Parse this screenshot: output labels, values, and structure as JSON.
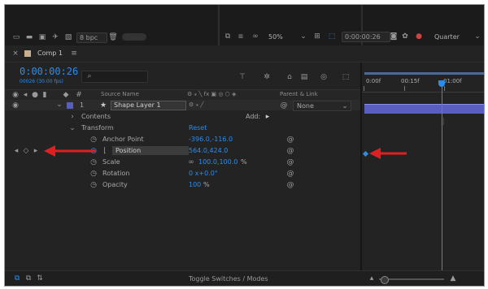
{
  "top": {
    "bpc": "8 bpc",
    "zoom": "50%",
    "timecode": "0:00:00:26",
    "resolution": "Quarter"
  },
  "comp": {
    "tab_label": "Comp 1",
    "timecode": "0:00:00:26",
    "frame_info": "00026 (30.00 fps)",
    "search_placeholder": ""
  },
  "columns": {
    "source_name": "Source Name",
    "parent_link": "Parent & Link"
  },
  "ruler": {
    "ticks": [
      "0:00f",
      "00:15f",
      "01:00f"
    ]
  },
  "layer": {
    "index": "1",
    "name": "Shape Layer 1",
    "parent": "None"
  },
  "props": {
    "contents": "Contents",
    "add_label": "Add:",
    "transform": "Transform",
    "reset": "Reset",
    "anchor_label": "Anchor Point",
    "anchor_value": "-396.0,-116.0",
    "position_label": "Position",
    "position_value": "564.0,424.0",
    "scale_label": "Scale",
    "scale_value": "100.0,100.0",
    "scale_unit": "%",
    "rotation_label": "Rotation",
    "rotation_value": "0 x+0.0°",
    "opacity_label": "Opacity",
    "opacity_value": "100",
    "opacity_unit": "%"
  },
  "bottom": {
    "toggle_label": "Toggle Switches / Modes"
  },
  "colors": {
    "accent_blue": "#2d8ceb",
    "arrow_red": "#e02020",
    "layer_bar": "#5a5fbf"
  }
}
